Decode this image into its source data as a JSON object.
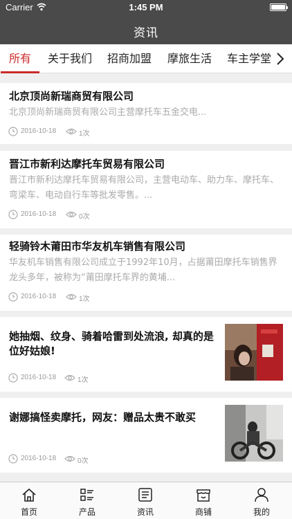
{
  "status": {
    "carrier": "Carrier",
    "time": "1:45 PM"
  },
  "header": {
    "title": "资讯"
  },
  "tabs": [
    {
      "label": "所有"
    },
    {
      "label": "关于我们"
    },
    {
      "label": "招商加盟"
    },
    {
      "label": "摩旅生活"
    },
    {
      "label": "车主学堂"
    }
  ],
  "articles": [
    {
      "title": "北京顶尚新瑞商贸有限公司",
      "summary": "北京顶尚新瑞商贸有限公司主营摩托车五金交电...",
      "date": "2016-10-18",
      "views": "1次"
    },
    {
      "title": "晋江市新利达摩托车贸易有限公司",
      "summary": "晋江市新利达摩托车贸易有限公司，主营电动车、助力车、摩托车、弯梁车、电动自行车等批发零售。...",
      "date": "2016-10-18",
      "views": "0次"
    },
    {
      "title": "轻骑铃木莆田市华友机车销售有限公司",
      "summary": "华友机车销售有限公司成立于1992年10月，占据莆田摩托车销售界龙头多年，被称为“莆田摩托车界的黄埔...",
      "date": "2016-10-18",
      "views": "1次"
    },
    {
      "title": "她抽烟、纹身、骑着哈雷到处流浪, 却真的是位好姑娘!",
      "date": "2016-10-18",
      "views": "1次"
    },
    {
      "title": "谢娜搞怪卖摩托，网友：赠品太贵不敢买",
      "date": "2016-10-18",
      "views": "0次"
    }
  ],
  "tabbar": [
    {
      "label": "首页",
      "icon": "home-icon"
    },
    {
      "label": "产品",
      "icon": "list-icon"
    },
    {
      "label": "资讯",
      "icon": "news-icon"
    },
    {
      "label": "商铺",
      "icon": "shop-icon"
    },
    {
      "label": "我的",
      "icon": "user-icon"
    }
  ]
}
